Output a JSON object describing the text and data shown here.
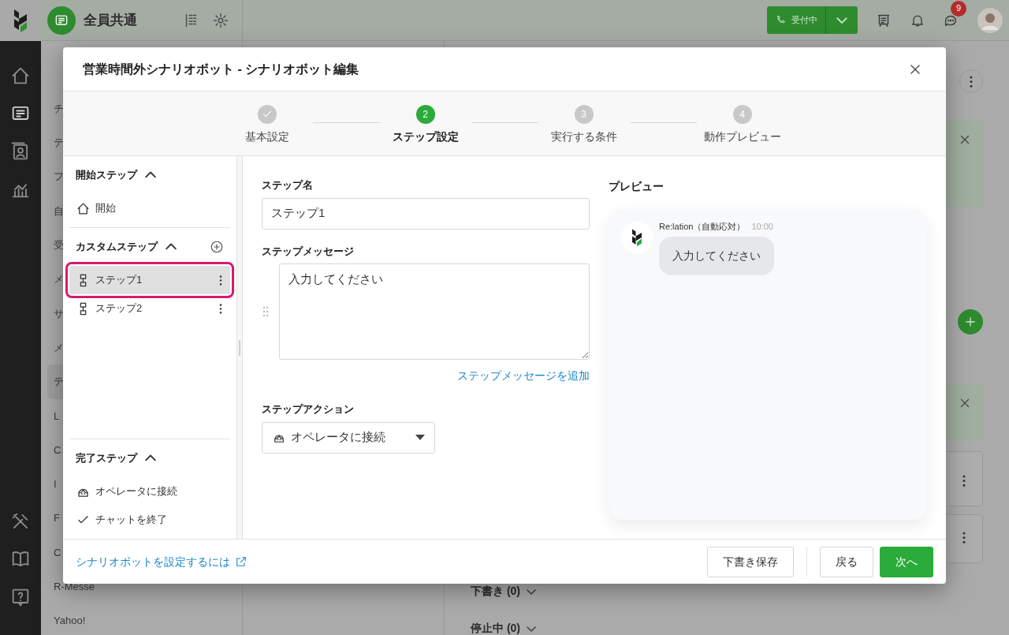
{
  "top_bar": {
    "workspace": "全員共通",
    "status_button": "受付中",
    "chat_badge": "9"
  },
  "background": {
    "list_fragments": [
      {
        "text": "チ",
        "selected": false
      },
      {
        "text": "テ",
        "selected": false
      },
      {
        "text": "フ",
        "selected": false
      },
      {
        "text": "自",
        "selected": false
      },
      {
        "text": "受",
        "selected": false
      },
      {
        "text": "メ",
        "selected": false
      },
      {
        "text": "サ",
        "selected": false
      },
      {
        "text": "メ",
        "selected": false
      },
      {
        "text": "テ",
        "selected": true
      },
      {
        "text": "L",
        "selected": false
      },
      {
        "text": "C",
        "selected": false
      },
      {
        "text": "I",
        "selected": false
      },
      {
        "text": "F",
        "selected": false
      },
      {
        "text": "C",
        "selected": false
      },
      {
        "text": "R-Messe",
        "selected": false
      },
      {
        "text": "Yahoo!",
        "selected": false
      }
    ],
    "sections": [
      {
        "label": "下書き (0)",
        "expanded": false
      },
      {
        "label": "停止中 (0)",
        "expanded": false
      }
    ]
  },
  "dialog": {
    "title": "営業時間外シナリオボット - シナリオボット編集",
    "steps": [
      {
        "label": "基本設定",
        "done": true,
        "selected": false
      },
      {
        "number": "2",
        "label": "ステップ設定",
        "done": false,
        "selected": true
      },
      {
        "number": "3",
        "label": "実行する条件",
        "done": false,
        "selected": false
      },
      {
        "number": "4",
        "label": "動作プレビュー",
        "done": false,
        "selected": false
      }
    ],
    "step_groups": [
      {
        "title": "開始ステップ",
        "expanded": true,
        "can_add": false,
        "items": [
          {
            "label": "開始",
            "kind": "start",
            "selected": false
          }
        ]
      },
      {
        "title": "カスタムステップ",
        "expanded": true,
        "can_add": true,
        "items": [
          {
            "label": "ステップ1",
            "kind": "custom",
            "selected": true
          },
          {
            "label": "ステップ2",
            "kind": "custom",
            "selected": false
          }
        ]
      },
      {
        "title": "完了ステップ",
        "expanded": true,
        "can_add": false,
        "items": [
          {
            "label": "オペレータに接続",
            "kind": "operator",
            "selected": false
          },
          {
            "label": "チャットを終了",
            "kind": "end",
            "selected": false
          }
        ]
      }
    ],
    "step_name": {
      "label": "ステップ名",
      "value": "ステップ1"
    },
    "step_message": {
      "label": "ステップメッセージ",
      "value": "入力してください"
    },
    "add_message_link": "ステップメッセージを追加",
    "step_action": {
      "label": "ステップアクション",
      "value": "オペレータに接続"
    },
    "preview": {
      "title": "プレビュー",
      "sender": "Re:lation（自動応対）",
      "time": "10:00",
      "message": "入力してください"
    },
    "help_link": "シナリオボットを設定するには",
    "buttons": [
      {
        "label": "下書き保存",
        "kind": "secondary"
      },
      {
        "label": "戻る",
        "kind": "secondary"
      },
      {
        "label": "次へ",
        "kind": "primary"
      }
    ]
  }
}
